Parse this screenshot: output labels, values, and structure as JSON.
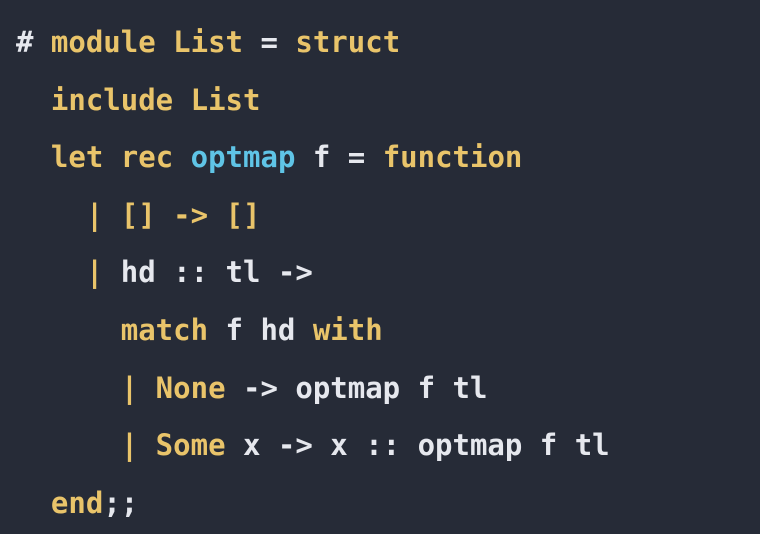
{
  "colors": {
    "background": "#262b37",
    "keyword": "#e9c46a",
    "function_name": "#5fc4e6",
    "text": "#e6e8ee"
  },
  "code": {
    "language": "OCaml",
    "lines": [
      {
        "name": "line-1",
        "tokens": [
          {
            "text": "# ",
            "kind": "text"
          },
          {
            "text": "module",
            "kind": "keyword"
          },
          {
            "text": " ",
            "kind": "text"
          },
          {
            "text": "List",
            "kind": "keyword"
          },
          {
            "text": " = ",
            "kind": "text"
          },
          {
            "text": "struct",
            "kind": "keyword"
          }
        ]
      },
      {
        "name": "line-2",
        "tokens": [
          {
            "text": "  ",
            "kind": "text"
          },
          {
            "text": "include",
            "kind": "keyword"
          },
          {
            "text": " ",
            "kind": "text"
          },
          {
            "text": "List",
            "kind": "keyword"
          }
        ]
      },
      {
        "name": "line-3",
        "tokens": [
          {
            "text": "  ",
            "kind": "text"
          },
          {
            "text": "let",
            "kind": "keyword"
          },
          {
            "text": " ",
            "kind": "text"
          },
          {
            "text": "rec",
            "kind": "keyword"
          },
          {
            "text": " ",
            "kind": "text"
          },
          {
            "text": "optmap",
            "kind": "function_name"
          },
          {
            "text": " f = ",
            "kind": "text"
          },
          {
            "text": "function",
            "kind": "keyword"
          }
        ]
      },
      {
        "name": "line-4",
        "tokens": [
          {
            "text": "    ",
            "kind": "text"
          },
          {
            "text": "| [] -> []",
            "kind": "keyword"
          }
        ]
      },
      {
        "name": "line-5",
        "tokens": [
          {
            "text": "    ",
            "kind": "text"
          },
          {
            "text": "|",
            "kind": "keyword"
          },
          {
            "text": " hd :: tl ->",
            "kind": "text"
          }
        ]
      },
      {
        "name": "line-6",
        "tokens": [
          {
            "text": "      ",
            "kind": "text"
          },
          {
            "text": "match",
            "kind": "keyword"
          },
          {
            "text": " f hd ",
            "kind": "text"
          },
          {
            "text": "with",
            "kind": "keyword"
          }
        ]
      },
      {
        "name": "line-7",
        "tokens": [
          {
            "text": "      ",
            "kind": "text"
          },
          {
            "text": "| None",
            "kind": "keyword"
          },
          {
            "text": " -> optmap f tl",
            "kind": "text"
          }
        ]
      },
      {
        "name": "line-8",
        "tokens": [
          {
            "text": "      ",
            "kind": "text"
          },
          {
            "text": "| Some",
            "kind": "keyword"
          },
          {
            "text": " x -> x :: optmap f tl",
            "kind": "text"
          }
        ]
      },
      {
        "name": "line-9",
        "tokens": [
          {
            "text": "  ",
            "kind": "text"
          },
          {
            "text": "end",
            "kind": "keyword"
          },
          {
            "text": ";;",
            "kind": "text"
          }
        ]
      }
    ]
  }
}
